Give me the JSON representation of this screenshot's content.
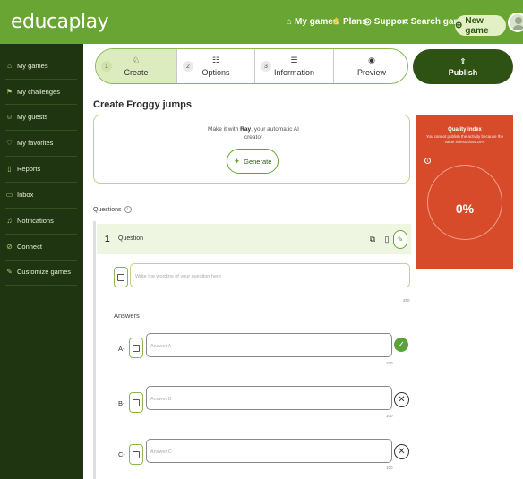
{
  "app": {
    "logo": "educaplay"
  },
  "topnav": {
    "my_games": "My games",
    "plans": "Plans",
    "support": "Support",
    "search_games": "Search games",
    "new_game": "New game"
  },
  "sidebar": {
    "items": [
      {
        "label": "My games",
        "icon": "gamepad-icon"
      },
      {
        "label": "My challenges",
        "icon": "flag-icon"
      },
      {
        "label": "My guests",
        "icon": "users-icon"
      },
      {
        "label": "My favorites",
        "icon": "heart-icon"
      },
      {
        "label": "Reports",
        "icon": "document-icon"
      },
      {
        "label": "Inbox",
        "icon": "inbox-icon"
      },
      {
        "label": "Notifications",
        "icon": "bell-icon"
      },
      {
        "label": "Connect",
        "icon": "link-icon"
      },
      {
        "label": "Customize games",
        "icon": "brush-icon"
      }
    ]
  },
  "stepper": {
    "steps": [
      {
        "num": "1",
        "label": "Create",
        "icon": "create-icon",
        "active": true
      },
      {
        "num": "2",
        "label": "Options",
        "icon": "sliders-icon",
        "active": false
      },
      {
        "num": "3",
        "label": "Information",
        "icon": "list-icon",
        "active": false
      },
      {
        "num": "",
        "label": "Preview",
        "icon": "eye-icon",
        "active": false
      }
    ],
    "publish_label": "Publish"
  },
  "page": {
    "title": "Create Froggy jumps"
  },
  "ai": {
    "text_prefix": "Make it with",
    "text_brand": "Ray",
    "text_suffix": ", your automatic AI creator",
    "generate_label": "Generate"
  },
  "quality": {
    "title": "Quality index",
    "description": "You cannot publish the activity because the value is less than 25%",
    "value": "0%",
    "color": "#d74b2b"
  },
  "questions": {
    "label": "Questions",
    "items": [
      {
        "number": "1",
        "name": "Question",
        "placeholder": "Write the wording of your question here",
        "max_chars": "250",
        "answers_label": "Answers",
        "answers": [
          {
            "letter": "A-",
            "placeholder": "Answer A",
            "max_chars": "100",
            "correct": true
          },
          {
            "letter": "B-",
            "placeholder": "Answer B",
            "max_chars": "100",
            "correct": false
          },
          {
            "letter": "C-",
            "placeholder": "Answer C",
            "max_chars": "100",
            "correct": false
          }
        ]
      }
    ]
  },
  "colors": {
    "brand_green": "#69a532",
    "sidebar_bg": "#1f3410",
    "publish_bg": "#2d5214",
    "correct_green": "#5aa33a"
  }
}
